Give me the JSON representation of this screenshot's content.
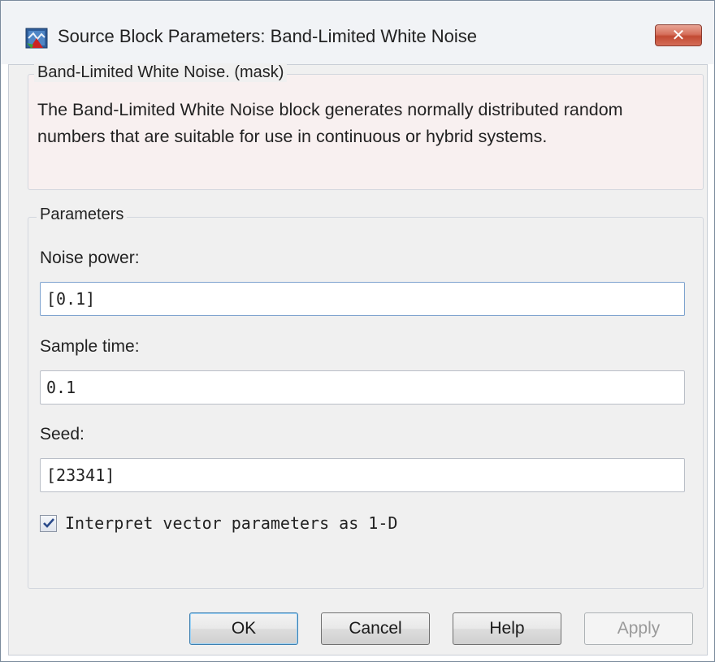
{
  "window": {
    "title": "Source Block Parameters: Band-Limited White Noise",
    "close_glyph": "✕",
    "app_icon": "simulink-block-icon"
  },
  "description_group": {
    "legend": "Band-Limited White Noise. (mask)",
    "text": "The Band-Limited White Noise block generates normally distributed random numbers that are suitable for use in continuous or hybrid systems."
  },
  "parameters_group": {
    "legend": "Parameters",
    "noise_power": {
      "label": "Noise power:",
      "value": "[0.1]"
    },
    "sample_time": {
      "label": "Sample time:",
      "value": "0.1"
    },
    "seed": {
      "label": "Seed:",
      "value": "[23341]"
    },
    "interpret_vector": {
      "label": "Interpret vector parameters as 1-D",
      "checked": true
    }
  },
  "buttons": {
    "ok": "OK",
    "cancel": "Cancel",
    "help": "Help",
    "apply": "Apply"
  },
  "colors": {
    "close_button": "#c7513a",
    "default_button_border": "#3c7fb1"
  }
}
